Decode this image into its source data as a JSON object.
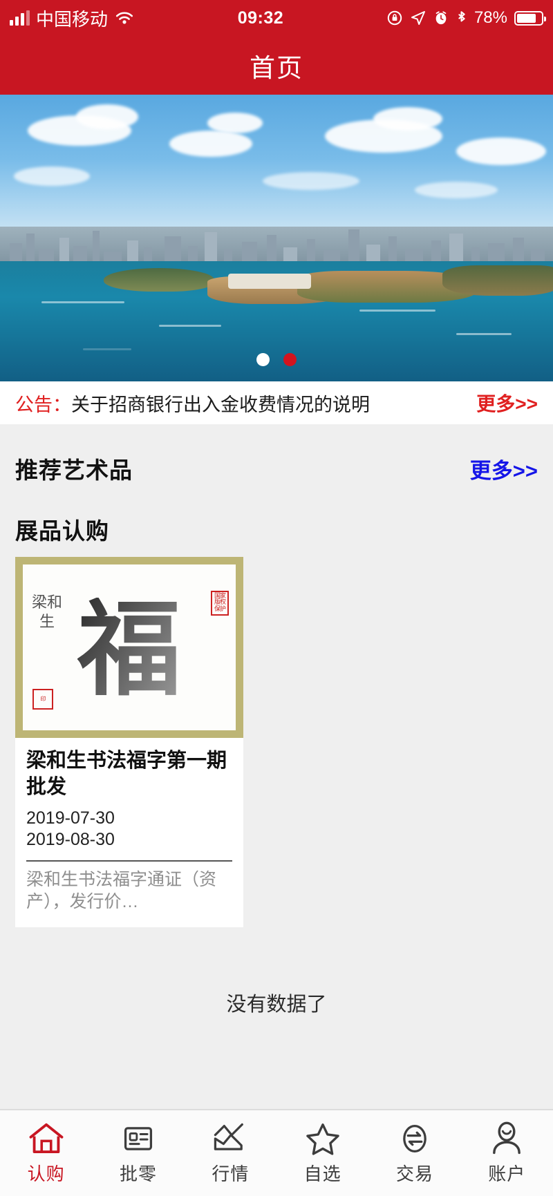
{
  "status_bar": {
    "carrier": "中国移动",
    "time": "09:32",
    "battery_percent": "78%",
    "icons": [
      "signal-icon",
      "wifi-icon",
      "rotation-lock-icon",
      "location-arrow-icon",
      "alarm-clock-icon",
      "bluetooth-icon",
      "battery-icon"
    ]
  },
  "header": {
    "title": "首页"
  },
  "banner": {
    "alt": "青岛海滨城市全景",
    "dots": [
      {
        "name": "carousel-dot-1",
        "state": "active",
        "color": "#ffffff"
      },
      {
        "name": "carousel-dot-2",
        "state": "inactive",
        "color": "#d3141e"
      }
    ]
  },
  "notice": {
    "label": "公告：",
    "text": "关于招商银行出入金收费情况的说明",
    "more_label": "更多>>",
    "label_color": "#e02020",
    "more_color": "#e02020"
  },
  "sections": [
    {
      "title": "推荐艺术品",
      "more_label": "更多>>",
      "more_color": "#1515e8"
    },
    {
      "title": "展品认购"
    }
  ],
  "products": [
    {
      "title": "梁和生书法福字第一期批发",
      "start_date": "2019-07-30",
      "end_date": "2019-08-30",
      "description": "梁和生书法福字通证（资产），发行价…",
      "image": {
        "name": "calligraphy-fu-artwork",
        "main_glyph": "福",
        "side_text": "梁和生",
        "seal_top_right": "国家版权保护",
        "seal_bottom_left": "印",
        "frame_color": "#bdb575"
      }
    }
  ],
  "footer_status": {
    "text": "没有数据了"
  },
  "tabbar": {
    "active_color": "#C81622",
    "inactive_color": "#3d3d3d",
    "items": [
      {
        "label": "认购",
        "icon": "home-icon",
        "active": true
      },
      {
        "label": "批零",
        "icon": "id-card-icon",
        "active": false
      },
      {
        "label": "行情",
        "icon": "line-chart-icon",
        "active": false
      },
      {
        "label": "自选",
        "icon": "star-icon",
        "active": false
      },
      {
        "label": "交易",
        "icon": "exchange-icon",
        "active": false
      },
      {
        "label": "账户",
        "icon": "user-icon",
        "active": false
      }
    ]
  }
}
